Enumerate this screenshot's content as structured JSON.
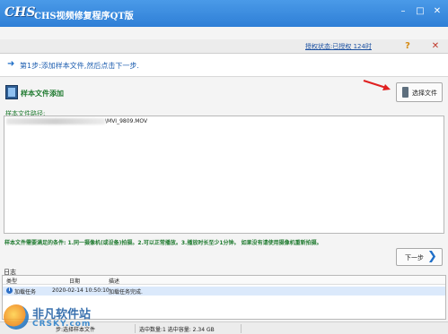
{
  "window": {
    "logo_text": "CHS",
    "title": "CHS视频修复程序QT版",
    "minimize_glyph": "–",
    "maximize_glyph": "□",
    "close_glyph": "✕"
  },
  "toolbar": {
    "license_text": "授权状态:已授权 124时",
    "help_glyph": "?",
    "close_glyph": "✕"
  },
  "step": {
    "text": "第1步:添加样本文件,然后点击下一步."
  },
  "sample": {
    "header_label": "样本文件添加",
    "select_button_label": "选择文件",
    "list_caption": "样本文件路径:",
    "files": [
      "\\MVI_9809.MOV"
    ]
  },
  "conditions_text": "样本文件需要满足的条件: 1.同一摄像机(或设备)拍摄。2.可以正常播放。3.播放时长至少1分钟。 如果没有请使用摄像机重新拍摄。",
  "next_button_label": "下一步",
  "log": {
    "caption": "日志",
    "columns": [
      "类型",
      "日期",
      "描述"
    ],
    "rows": [
      {
        "type": "加载任务",
        "date": "2020-02-14 10:50:10",
        "desc": "加载任务完成."
      }
    ]
  },
  "status": {
    "step_text": "步:选择样本文件",
    "selection_text": "选中数量:1 选中容量: 2.34 GB"
  },
  "watermark": {
    "text": "非凡软件站",
    "sub": "CRSKY.com"
  },
  "colors": {
    "titlebar": "#2f7fd6",
    "accent_green": "#1f7a2f",
    "link_blue": "#1a4fa0",
    "arrow_red": "#e02020"
  },
  "icons": {
    "app": "chs-logo-icon",
    "step": "arrow-right-icon",
    "sample": "film-icon",
    "select": "phone-icon",
    "next": "chevron-right-icon",
    "log_info": "info-icon",
    "help": "help-icon"
  }
}
